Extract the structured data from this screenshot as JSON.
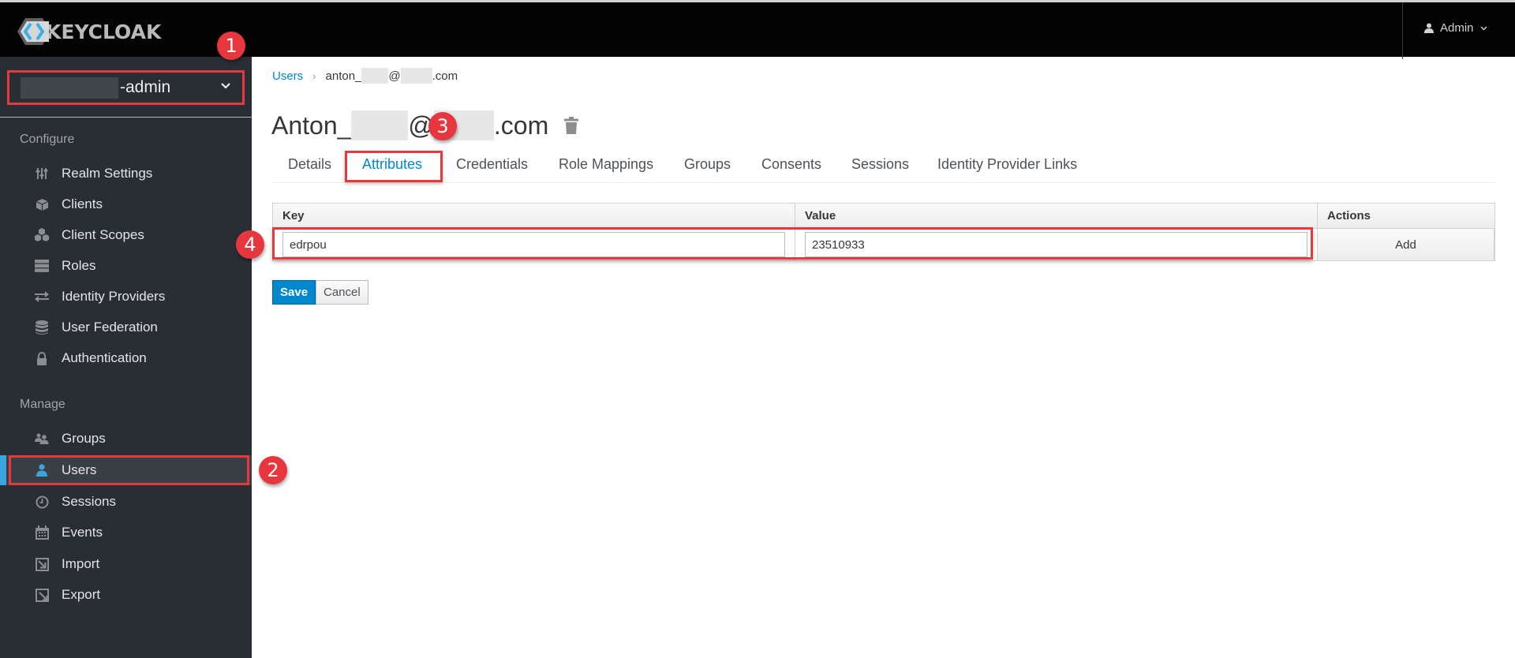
{
  "header": {
    "logo_text": "KEYCLOAK",
    "user_menu_label": "Admin"
  },
  "sidebar": {
    "realm_selector": {
      "label_suffix": "-admin"
    },
    "sections": [
      {
        "title": "Configure",
        "items": [
          {
            "label": "Realm Settings",
            "icon": "sliders-icon"
          },
          {
            "label": "Clients",
            "icon": "cube-icon"
          },
          {
            "label": "Client Scopes",
            "icon": "cubes-icon"
          },
          {
            "label": "Roles",
            "icon": "server-icon"
          },
          {
            "label": "Identity Providers",
            "icon": "exchange-icon"
          },
          {
            "label": "User Federation",
            "icon": "database-icon"
          },
          {
            "label": "Authentication",
            "icon": "lock-icon"
          }
        ]
      },
      {
        "title": "Manage",
        "items": [
          {
            "label": "Groups",
            "icon": "users-icon"
          },
          {
            "label": "Users",
            "icon": "user-icon",
            "active": true
          },
          {
            "label": "Sessions",
            "icon": "clock-icon"
          },
          {
            "label": "Events",
            "icon": "calendar-icon"
          },
          {
            "label": "Import",
            "icon": "import-icon"
          },
          {
            "label": "Export",
            "icon": "export-icon"
          }
        ]
      }
    ]
  },
  "breadcrumb": {
    "parent": "Users",
    "current_prefix": "anton_",
    "current_at": "@",
    "current_suffix": ".com"
  },
  "page_title": {
    "prefix": "Anton_",
    "at": "@",
    "suffix": ".com"
  },
  "tabs": [
    {
      "label": "Details"
    },
    {
      "label": "Attributes",
      "active": true
    },
    {
      "label": "Credentials"
    },
    {
      "label": "Role Mappings"
    },
    {
      "label": "Groups"
    },
    {
      "label": "Consents"
    },
    {
      "label": "Sessions"
    },
    {
      "label": "Identity Provider Links"
    }
  ],
  "attributes_table": {
    "columns": [
      "Key",
      "Value",
      "Actions"
    ],
    "new_row": {
      "key": "edrpou",
      "value": "23510933",
      "action_label": "Add"
    }
  },
  "buttons": {
    "save": "Save",
    "cancel": "Cancel"
  },
  "annotations": [
    "1",
    "2",
    "3",
    "4"
  ],
  "colors": {
    "accent": "#0088ce",
    "sidebar_bg": "#292e34",
    "highlight": "#e6393e",
    "active_bar": "#39a5dc"
  }
}
